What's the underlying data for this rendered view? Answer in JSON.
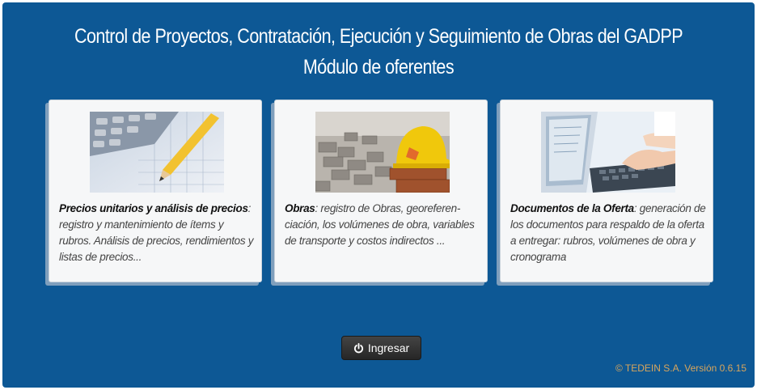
{
  "header": {
    "title": "Control de Proyectos, Contratación, Ejecución y Seguimiento de Obras del GADPP",
    "subtitle": "Módulo de oferentes"
  },
  "cards": [
    {
      "heading": "Precios unitarios y análisis de precios",
      "description": ": registro y mantenimiento de ítems y rubros. Análisis de precios, rendimientos y listas de precios...",
      "image": "calculator-pencil-photo"
    },
    {
      "heading": "Obras",
      "description": ": registro de Obras, georeferen-ciación, los volúmenes de obra, variables de transporte y costos indirectos ...",
      "image": "hardhat-bricks-photo"
    },
    {
      "heading": "Documentos de la Oferta",
      "description": ": generación de los documentos para respaldo de la oferta a entregar: rubros, volúmenes de obra y cronograma",
      "image": "keyboard-typing-photo"
    }
  ],
  "login_button": {
    "label": "Ingresar",
    "icon": "power-icon"
  },
  "footer": {
    "text": "© TEDEIN S.A. Versión 0.6.15"
  },
  "colors": {
    "panel": "#0d5895",
    "footer_text": "#d8a55c",
    "button": "#333333"
  }
}
